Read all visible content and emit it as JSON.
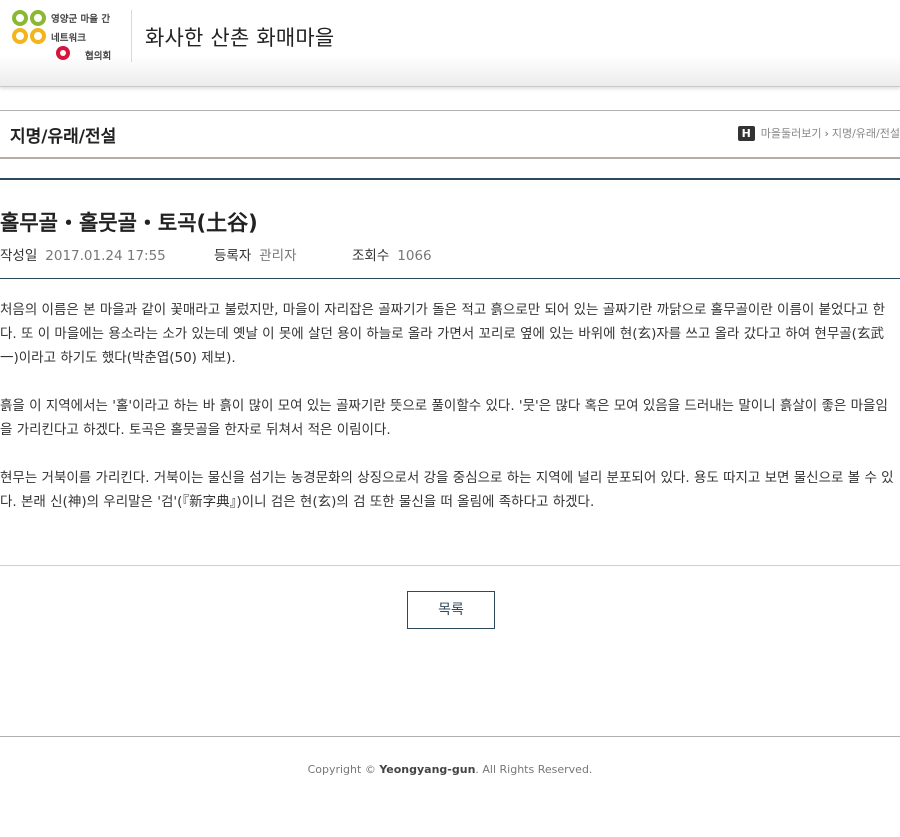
{
  "header": {
    "logo": {
      "line1": "영양군 마을 간",
      "line2": "네트워크",
      "line3": "협의회"
    },
    "site_title": "화사한 산촌 화매마을"
  },
  "title_bar": {
    "title": "지명/유래/전설",
    "home_icon_label": "H",
    "breadcrumb": [
      "마을둘러보기",
      "지명/유래/전설"
    ]
  },
  "article": {
    "title": "홀무골・홀뭇골・토곡(土谷)",
    "meta": {
      "date_label": "작성일",
      "date_value": "2017.01.24 17:55",
      "author_label": "등록자",
      "author_value": "관리자",
      "views_label": "조회수",
      "views_value": "1066"
    },
    "paragraphs": [
      "처음의 이름은 본 마을과 같이 꽃매라고 불렀지만, 마을이 자리잡은 골짜기가 돌은 적고 흙으로만 되어 있는 골짜기란 까닭으로 홀무골이란 이름이 붙었다고 한다. 또 이 마을에는 용소라는 소가 있는데 옛날 이 못에 살던 용이 하늘로 올라 가면서 꼬리로 옆에 있는 바위에 현(玄)자를 쓰고 올라 갔다고 하여 현무골(玄武一)이라고 하기도 했다(박춘엽(50) 제보).",
      "흙을 이 지역에서는 '홀'이라고 하는 바 흙이 많이 모여 있는 골짜기란 뜻으로 풀이할수 있다. '뭇'은 많다 혹은 모여 있음을 드러내는 말이니 흙살이 좋은 마을임을 가리킨다고 하겠다. 토곡은 홀뭇골을 한자로 뒤쳐서 적은 이림이다.",
      "현무는 거북이를 가리킨다. 거북이는 물신을 섬기는 농경문화의 상징으로서 강을 중심으로 하는 지역에 널리 분포되어 있다. 용도 따지고 보면 물신으로 볼 수 있다. 본래 신(神)의 우리말은 '검'(『新字典』)이니 검은 현(玄)의 검 또한 물신을 떠 올림에 족하다고 하겠다."
    ],
    "list_button": "목록"
  },
  "footer": {
    "prefix": "Copyright ©",
    "brand": "Yeongyang-gun",
    "suffix": ". All Rights Reserved."
  },
  "colors": {
    "accent": "#2d4a5c",
    "logo_green": "#8ab832",
    "logo_yellow": "#f2b61c",
    "logo_red": "#d7143c"
  }
}
